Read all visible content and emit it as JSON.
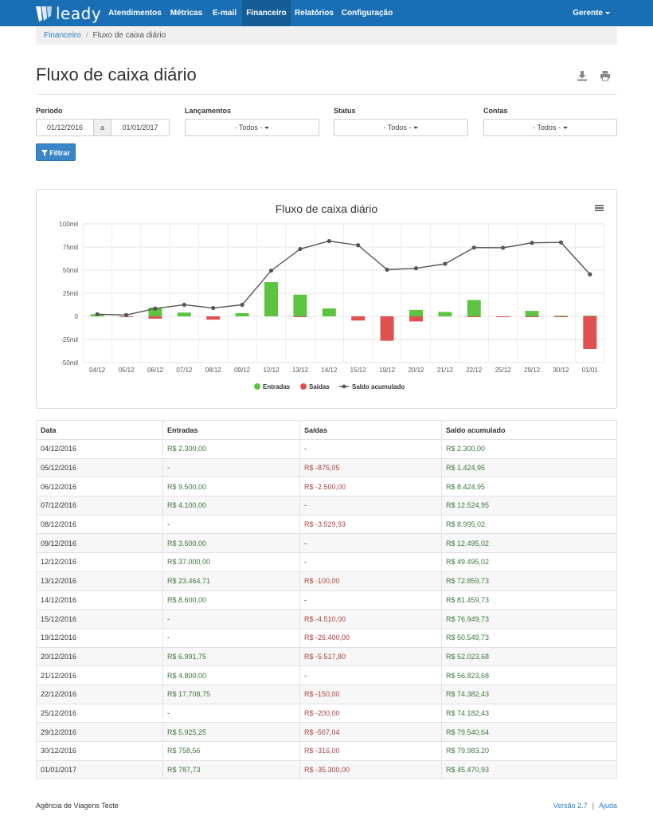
{
  "brand": {
    "name": "leady"
  },
  "nav": {
    "items": [
      {
        "label": "Atendimentos",
        "active": false
      },
      {
        "label": "Métricas",
        "active": false
      },
      {
        "label": "E-mail",
        "active": false
      },
      {
        "label": "Financeiro",
        "active": true
      },
      {
        "label": "Relatórios",
        "active": false
      },
      {
        "label": "Configuração",
        "active": false
      }
    ],
    "user": "Gerente"
  },
  "breadcrumb": {
    "parent": "Financeiro",
    "current": "Fluxo de caixa diário"
  },
  "page": {
    "title": "Fluxo de caixa diário"
  },
  "icons": {
    "download": "download-icon",
    "print": "print-icon",
    "filter": "filter-icon",
    "menu": "hamburger-menu-icon"
  },
  "filters": {
    "periodo": {
      "label": "Período",
      "from": "01/12/2016",
      "sep": "a",
      "to": "01/01/2017"
    },
    "lancamentos": {
      "label": "Lançamentos",
      "value": "- Todos -"
    },
    "status": {
      "label": "Status",
      "value": "- Todos -"
    },
    "contas": {
      "label": "Contas",
      "value": "- Todos -"
    },
    "button": "Filtrar"
  },
  "colors": {
    "primary": "#1a6fb4",
    "entradas": "#5cc440",
    "saidas": "#e05050",
    "saldo": "#555555",
    "positive": "#3c763d",
    "negative": "#a94442"
  },
  "chart_data": {
    "type": "bar",
    "title": "Fluxo de caixa diário",
    "categories": [
      "04/12",
      "05/12",
      "06/12",
      "07/12",
      "08/12",
      "09/12",
      "12/12",
      "13/12",
      "14/12",
      "15/12",
      "19/12",
      "20/12",
      "21/12",
      "22/12",
      "25/12",
      "29/12",
      "30/12",
      "01/01"
    ],
    "yticks": [
      "100mil",
      "75mil",
      "50mil",
      "25mil",
      "0",
      "-25mil",
      "-50mil"
    ],
    "ylim": [
      -50000,
      100000
    ],
    "series": [
      {
        "name": "Entradas",
        "type": "bar",
        "values": [
          2300,
          0,
          9500,
          4100,
          0,
          3500,
          37000,
          23464.71,
          8600,
          0,
          0,
          6991.75,
          4800,
          17708.75,
          0,
          5925.25,
          758.56,
          787.73
        ]
      },
      {
        "name": "Saídas",
        "type": "bar",
        "values": [
          0,
          -875.05,
          -2500,
          0,
          -3529.93,
          0,
          0,
          -100,
          0,
          -4510,
          -26400,
          -5517.8,
          0,
          -150,
          -200,
          -567.04,
          -316,
          -35300
        ]
      },
      {
        "name": "Saldo acumulado",
        "type": "line",
        "values": [
          2300,
          1424.95,
          8424.95,
          12524.95,
          8995.02,
          12495.02,
          49495.02,
          72859.73,
          81459.73,
          76949.73,
          50549.73,
          52023.68,
          56823.68,
          74382.43,
          74182.43,
          79540.64,
          79983.2,
          45470.93
        ]
      }
    ],
    "legend": "bottom-center",
    "grid": true
  },
  "table": {
    "headers": [
      "Data",
      "Entradas",
      "Saídas",
      "Saldo acumulado"
    ],
    "rows": [
      [
        "04/12/2016",
        "R$ 2.300,00",
        "-",
        "R$ 2.300,00"
      ],
      [
        "05/12/2016",
        "-",
        "R$ -875,05",
        "R$ 1.424,95"
      ],
      [
        "06/12/2016",
        "R$ 9.500,00",
        "R$ -2.500,00",
        "R$ 8.424,95"
      ],
      [
        "07/12/2016",
        "R$ 4.100,00",
        "-",
        "R$ 12.524,95"
      ],
      [
        "08/12/2016",
        "-",
        "R$ -3.529,93",
        "R$ 8.995,02"
      ],
      [
        "09/12/2016",
        "R$ 3.500,00",
        "-",
        "R$ 12.495,02"
      ],
      [
        "12/12/2016",
        "R$ 37.000,00",
        "-",
        "R$ 49.495,02"
      ],
      [
        "13/12/2016",
        "R$ 23.464,71",
        "R$ -100,00",
        "R$ 72.859,73"
      ],
      [
        "14/12/2016",
        "R$ 8.600,00",
        "-",
        "R$ 81.459,73"
      ],
      [
        "15/12/2016",
        "-",
        "R$ -4.510,00",
        "R$ 76.949,73"
      ],
      [
        "19/12/2016",
        "-",
        "R$ -26.400,00",
        "R$ 50.549,73"
      ],
      [
        "20/12/2016",
        "R$ 6.991,75",
        "R$ -5.517,80",
        "R$ 52.023,68"
      ],
      [
        "21/12/2016",
        "R$ 4.800,00",
        "-",
        "R$ 56.823,68"
      ],
      [
        "22/12/2016",
        "R$ 17.708,75",
        "R$ -150,00",
        "R$ 74.382,43"
      ],
      [
        "25/12/2016",
        "-",
        "R$ -200,00",
        "R$ 74.182,43"
      ],
      [
        "29/12/2016",
        "R$ 5.925,25",
        "R$ -567,04",
        "R$ 79.540,64"
      ],
      [
        "30/12/2016",
        "R$ 758,56",
        "R$ -316,00",
        "R$ 79.983,20"
      ],
      [
        "01/01/2017",
        "R$ 787,73",
        "R$ -35.300,00",
        "R$ 45.470,93"
      ]
    ]
  },
  "footer": {
    "company": "Agência de Viagens Teste",
    "version": "Versão 2.7",
    "separator": "|",
    "help": "Ajuda"
  }
}
